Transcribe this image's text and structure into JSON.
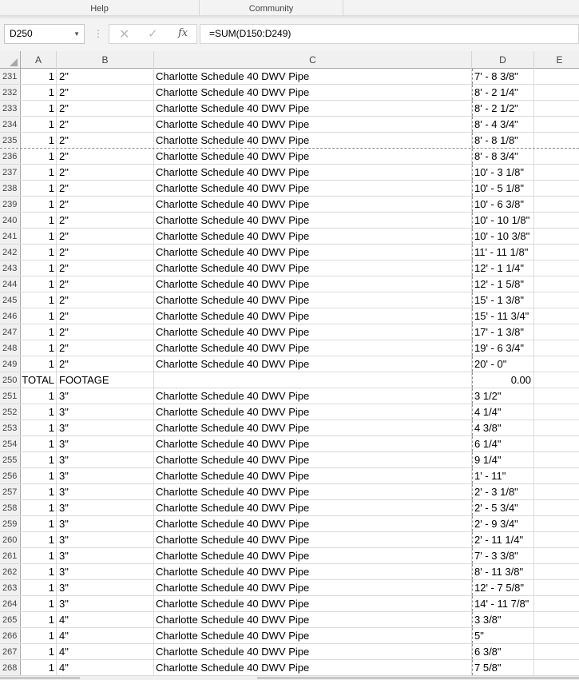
{
  "ribbon": {
    "tabs": [
      "Help",
      "Community"
    ]
  },
  "formula_bar": {
    "name_box": "D250",
    "fx_label": "fx",
    "formula": "=SUM(D150:D249)"
  },
  "columns": [
    "A",
    "B",
    "C",
    "D",
    "E"
  ],
  "rows": [
    {
      "n": "231",
      "a": "1",
      "b": "2\"",
      "c": "Charlotte Schedule 40 DWV Pipe",
      "d": "7' - 8 3/8\""
    },
    {
      "n": "232",
      "a": "1",
      "b": "2\"",
      "c": "Charlotte Schedule 40 DWV Pipe",
      "d": "8' - 2 1/4\""
    },
    {
      "n": "233",
      "a": "1",
      "b": "2\"",
      "c": "Charlotte Schedule 40 DWV Pipe",
      "d": "8' - 2 1/2\""
    },
    {
      "n": "234",
      "a": "1",
      "b": "2\"",
      "c": "Charlotte Schedule 40 DWV Pipe",
      "d": "8' - 4 3/4\""
    },
    {
      "n": "235",
      "a": "1",
      "b": "2\"",
      "c": "Charlotte Schedule 40 DWV Pipe",
      "d": "8' - 8 1/8\""
    },
    {
      "n": "236",
      "a": "1",
      "b": "2\"",
      "c": "Charlotte Schedule 40 DWV Pipe",
      "d": "8' - 8 3/4\""
    },
    {
      "n": "237",
      "a": "1",
      "b": "2\"",
      "c": "Charlotte Schedule 40 DWV Pipe",
      "d": "10' - 3 1/8\""
    },
    {
      "n": "238",
      "a": "1",
      "b": "2\"",
      "c": "Charlotte Schedule 40 DWV Pipe",
      "d": "10' - 5 1/8\""
    },
    {
      "n": "239",
      "a": "1",
      "b": "2\"",
      "c": "Charlotte Schedule 40 DWV Pipe",
      "d": "10' - 6 3/8\""
    },
    {
      "n": "240",
      "a": "1",
      "b": "2\"",
      "c": "Charlotte Schedule 40 DWV Pipe",
      "d": "10' - 10 1/8\""
    },
    {
      "n": "241",
      "a": "1",
      "b": "2\"",
      "c": "Charlotte Schedule 40 DWV Pipe",
      "d": "10' - 10 3/8\""
    },
    {
      "n": "242",
      "a": "1",
      "b": "2\"",
      "c": "Charlotte Schedule 40 DWV Pipe",
      "d": "11' - 11 1/8\""
    },
    {
      "n": "243",
      "a": "1",
      "b": "2\"",
      "c": "Charlotte Schedule 40 DWV Pipe",
      "d": "12' - 1 1/4\""
    },
    {
      "n": "244",
      "a": "1",
      "b": "2\"",
      "c": "Charlotte Schedule 40 DWV Pipe",
      "d": "12' - 1 5/8\""
    },
    {
      "n": "245",
      "a": "1",
      "b": "2\"",
      "c": "Charlotte Schedule 40 DWV Pipe",
      "d": "15' - 1 3/8\""
    },
    {
      "n": "246",
      "a": "1",
      "b": "2\"",
      "c": "Charlotte Schedule 40 DWV Pipe",
      "d": "15' - 11 3/4\""
    },
    {
      "n": "247",
      "a": "1",
      "b": "2\"",
      "c": "Charlotte Schedule 40 DWV Pipe",
      "d": "17' - 1 3/8\""
    },
    {
      "n": "248",
      "a": "1",
      "b": "2\"",
      "c": "Charlotte Schedule 40 DWV Pipe",
      "d": "19' - 6 3/4\""
    },
    {
      "n": "249",
      "a": "1",
      "b": "2\"",
      "c": "Charlotte Schedule 40 DWV Pipe",
      "d": "20' - 0\""
    },
    {
      "n": "250",
      "a": "TOTAL",
      "b": "FOOTAGE",
      "c": "",
      "d": "0.00",
      "num": true
    },
    {
      "n": "251",
      "a": "1",
      "b": "3\"",
      "c": "Charlotte Schedule 40 DWV Pipe",
      "d": "3 1/2\""
    },
    {
      "n": "252",
      "a": "1",
      "b": "3\"",
      "c": "Charlotte Schedule 40 DWV Pipe",
      "d": "4 1/4\""
    },
    {
      "n": "253",
      "a": "1",
      "b": "3\"",
      "c": "Charlotte Schedule 40 DWV Pipe",
      "d": "4 3/8\""
    },
    {
      "n": "254",
      "a": "1",
      "b": "3\"",
      "c": "Charlotte Schedule 40 DWV Pipe",
      "d": "6 1/4\""
    },
    {
      "n": "255",
      "a": "1",
      "b": "3\"",
      "c": "Charlotte Schedule 40 DWV Pipe",
      "d": "9 1/4\""
    },
    {
      "n": "256",
      "a": "1",
      "b": "3\"",
      "c": "Charlotte Schedule 40 DWV Pipe",
      "d": "1' - 11\""
    },
    {
      "n": "257",
      "a": "1",
      "b": "3\"",
      "c": "Charlotte Schedule 40 DWV Pipe",
      "d": "2' - 3 1/8\""
    },
    {
      "n": "258",
      "a": "1",
      "b": "3\"",
      "c": "Charlotte Schedule 40 DWV Pipe",
      "d": "2' - 5 3/4\""
    },
    {
      "n": "259",
      "a": "1",
      "b": "3\"",
      "c": "Charlotte Schedule 40 DWV Pipe",
      "d": "2' - 9 3/4\""
    },
    {
      "n": "260",
      "a": "1",
      "b": "3\"",
      "c": "Charlotte Schedule 40 DWV Pipe",
      "d": "2' - 11 1/4\""
    },
    {
      "n": "261",
      "a": "1",
      "b": "3\"",
      "c": "Charlotte Schedule 40 DWV Pipe",
      "d": "7' - 3 3/8\""
    },
    {
      "n": "262",
      "a": "1",
      "b": "3\"",
      "c": "Charlotte Schedule 40 DWV Pipe",
      "d": "8' - 11 3/8\""
    },
    {
      "n": "263",
      "a": "1",
      "b": "3\"",
      "c": "Charlotte Schedule 40 DWV Pipe",
      "d": "12' - 7 5/8\""
    },
    {
      "n": "264",
      "a": "1",
      "b": "3\"",
      "c": "Charlotte Schedule 40 DWV Pipe",
      "d": "14' - 11 7/8\""
    },
    {
      "n": "265",
      "a": "1",
      "b": "4\"",
      "c": "Charlotte Schedule 40 DWV Pipe",
      "d": "3 3/8\""
    },
    {
      "n": "266",
      "a": "1",
      "b": "4\"",
      "c": "Charlotte Schedule 40 DWV Pipe",
      "d": "5\""
    },
    {
      "n": "267",
      "a": "1",
      "b": "4\"",
      "c": "Charlotte Schedule 40 DWV Pipe",
      "d": "6 3/8\""
    },
    {
      "n": "268",
      "a": "1",
      "b": "4\"",
      "c": "Charlotte Schedule 40 DWV Pipe",
      "d": "7 5/8\""
    }
  ]
}
